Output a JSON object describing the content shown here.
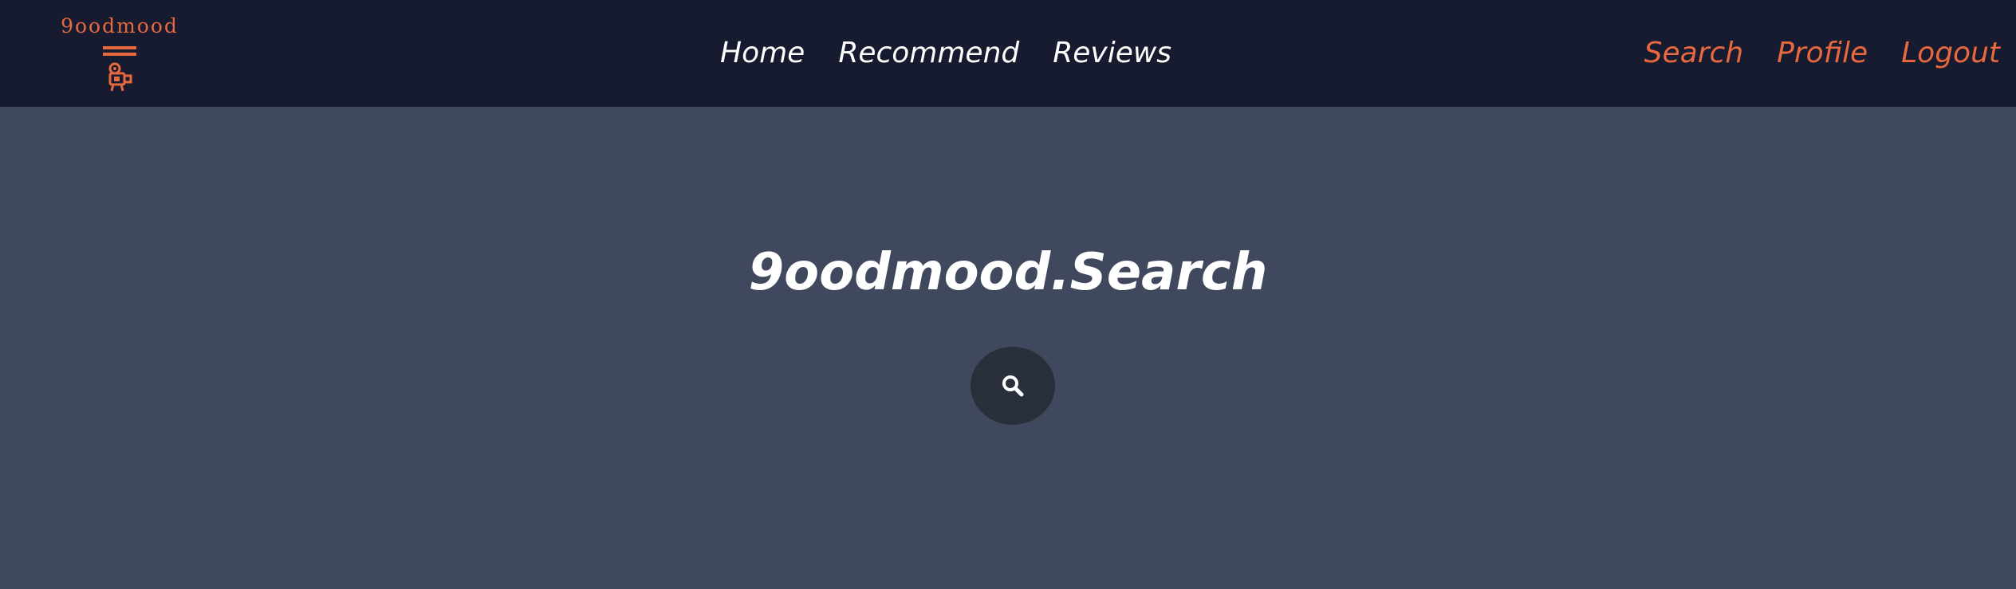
{
  "brand": {
    "logo_text": "9oodmood",
    "logo_icon": "film-camera-icon",
    "accent_color": "#e8683f"
  },
  "nav": {
    "center_items": [
      {
        "label": "Home"
      },
      {
        "label": "Recommend"
      },
      {
        "label": "Reviews"
      }
    ],
    "right_items": [
      {
        "label": "Search"
      },
      {
        "label": "Profile"
      },
      {
        "label": "Logout"
      }
    ]
  },
  "main": {
    "title": "9oodmood.Search",
    "search_button_icon": "search-icon"
  },
  "colors": {
    "navbar_bg": "#161b2f",
    "page_bg": "#3f485d",
    "button_bg": "#2a2f3c"
  }
}
